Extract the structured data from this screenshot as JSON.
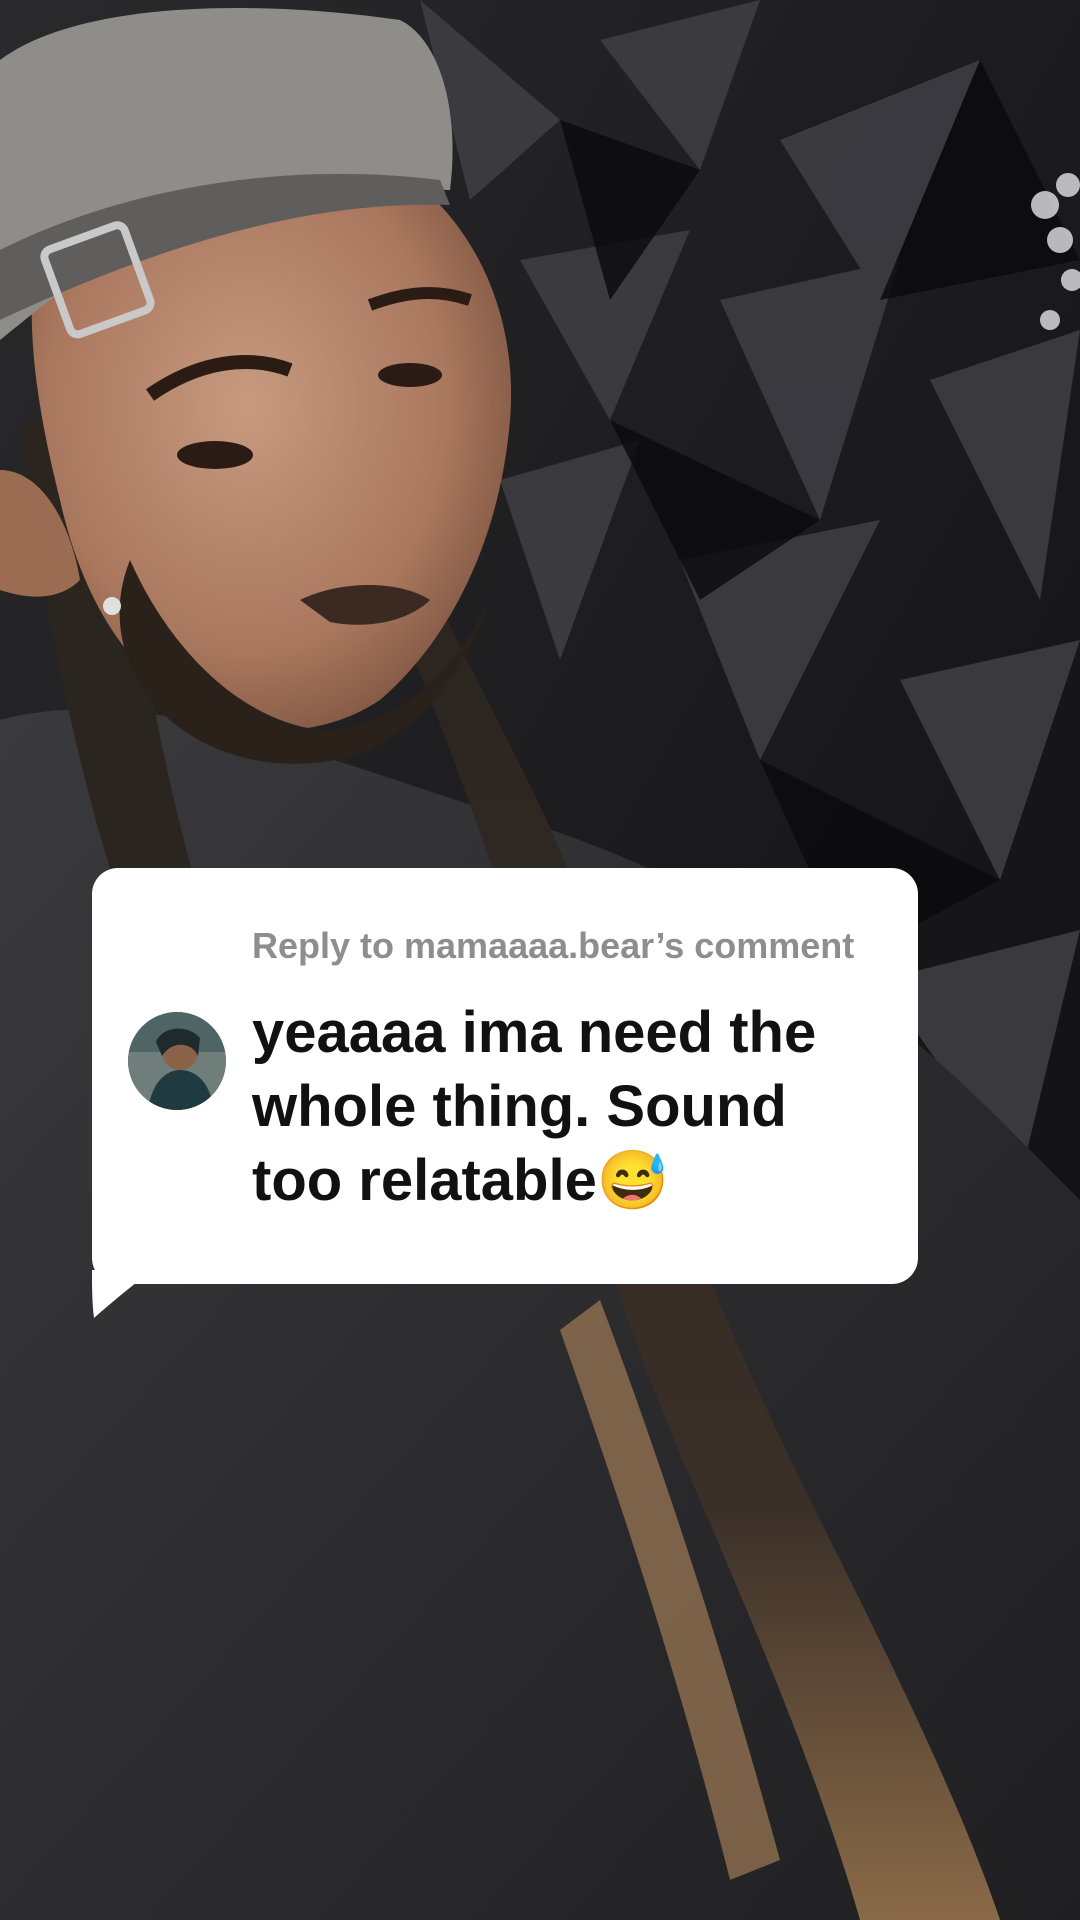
{
  "reply": {
    "header": "Reply to mamaaaa.bear’s comment",
    "comment": "yeaaaa ima need the whole thing. Sound too relatable😅",
    "avatar_icon": "user-avatar-icon"
  },
  "colors": {
    "card_bg": "#ffffff",
    "header_text": "#8e8e8e",
    "comment_text": "#111111"
  }
}
